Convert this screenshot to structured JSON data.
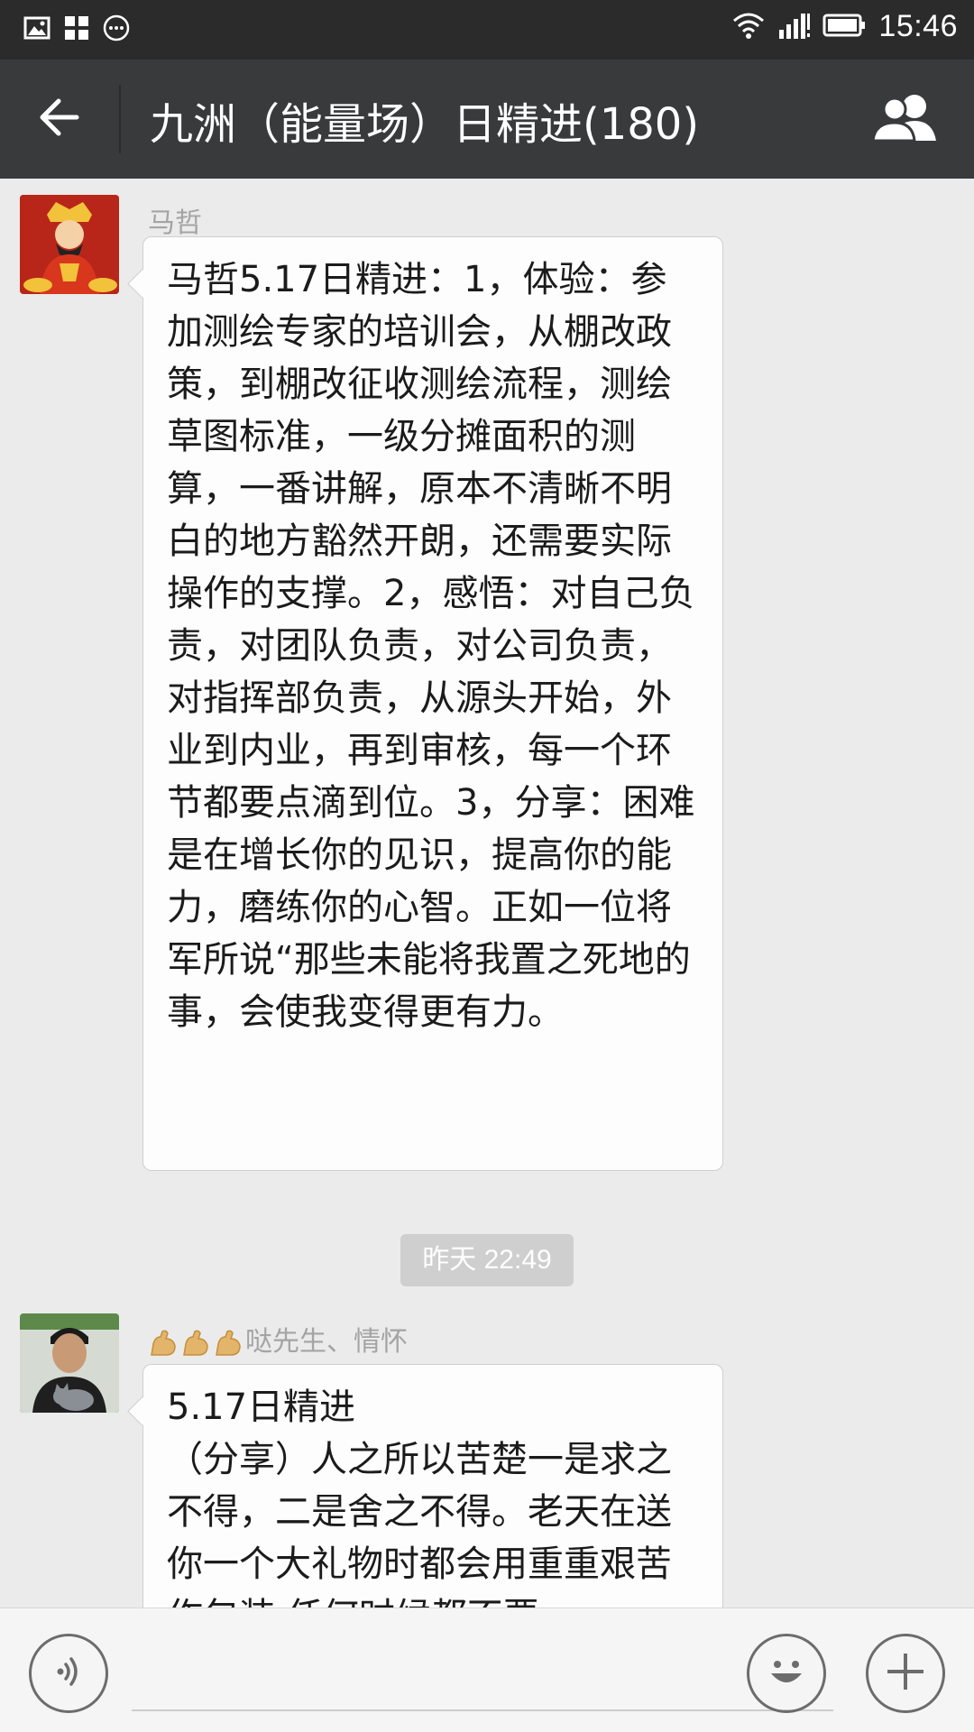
{
  "status_bar": {
    "time": "15:46",
    "icons": [
      "image-icon",
      "apps-icon",
      "more-dots-icon",
      "wifi-icon",
      "signal-icon",
      "battery-icon"
    ]
  },
  "title_bar": {
    "title": "九洲（能量场）日精进(180)",
    "back_icon": "back-arrow-icon",
    "members_icon": "group-members-icon",
    "text_color": "#ffffff",
    "background": "#383a3c"
  },
  "messages": [
    {
      "sender": "马哲",
      "avatar": "god-of-wealth-avatar",
      "text": "马哲5.17日精进：1，体验：参加测绘专家的培训会，从棚改政策，到棚改征收测绘流程，测绘草图标准，一级分摊面积的测算，一番讲解，原本不清晰不明白的地方豁然开朗，还需要实际操作的支撑。2，感悟：对自己负责，对团队负责，对公司负责，对指挥部负责，从源头开始，外业到内业，再到审核，每一个环节都要点滴到位。3，分享：困难是在增长你的见识，提高你的能力，磨练你的心智。正如一位将军所说“那些未能将我置之死地的事，会使我变得更有力。"
    },
    {
      "sender": "哒先生、情怀",
      "sender_emoji": "flexed-biceps",
      "sender_emoji_count": 3,
      "avatar": "young-man-with-cat-avatar",
      "text": "5.17日精进\n（分享）人之所以苦楚一是求之不得，二是舍之不得。老天在送你一个大礼物时都会用重重艰苦作包装,任何时候都不要"
    }
  ],
  "time_separator": "昨天 22:49",
  "input_bar": {
    "value": "",
    "voice_icon": "voice-icon",
    "emoji_icon": "emoji-icon",
    "plus_icon": "plus-icon"
  },
  "colors": {
    "chat_background": "#ebebeb",
    "bubble_background": "#fdfdfd",
    "sender_name": "#a4a4a4",
    "status_bar": "#2b2b2b"
  }
}
